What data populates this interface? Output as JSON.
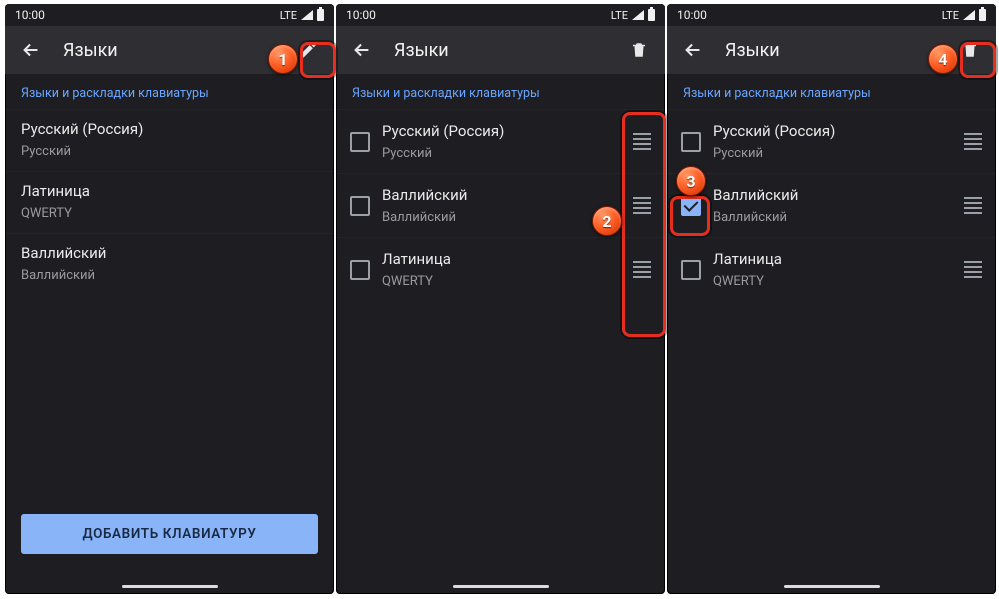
{
  "status": {
    "time": "10:00",
    "net": "LTE"
  },
  "appbar": {
    "title": "Языки"
  },
  "section_label": "Языки и раскладки клавиатуры",
  "add_button": "ДОБАВИТЬ КЛАВИАТУРУ",
  "panel1": {
    "items": [
      {
        "title": "Русский (Россия)",
        "sub": "Русский"
      },
      {
        "title": "Латиница",
        "sub": "QWERTY"
      },
      {
        "title": "Валлийский",
        "sub": "Валлийский"
      }
    ]
  },
  "panel2": {
    "items": [
      {
        "title": "Русский (Россия)",
        "sub": "Русский",
        "checked": false
      },
      {
        "title": "Валлийский",
        "sub": "Валлийский",
        "checked": false
      },
      {
        "title": "Латиница",
        "sub": "QWERTY",
        "checked": false
      }
    ]
  },
  "panel3": {
    "items": [
      {
        "title": "Русский (Россия)",
        "sub": "Русский",
        "checked": false
      },
      {
        "title": "Валлийский",
        "sub": "Валлийский",
        "checked": true
      },
      {
        "title": "Латиница",
        "sub": "QWERTY",
        "checked": false
      }
    ]
  },
  "badges": {
    "b1": "1",
    "b2": "2",
    "b3": "3",
    "b4": "4"
  }
}
